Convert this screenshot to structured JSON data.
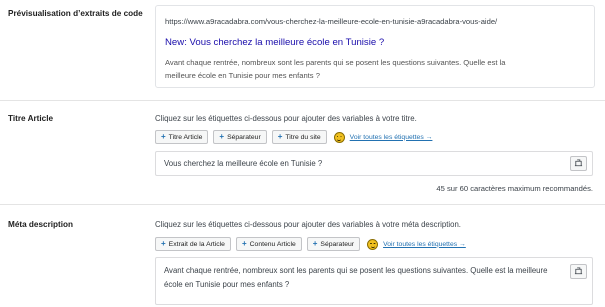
{
  "snippet_preview": {
    "label": "Prévisualisation d’extraits de code",
    "url": "https://www.a9racadabra.com/vous-cherchez-la-meilleure-ecole-en-tunisie-a9racadabra-vous-aide/",
    "title": "New: Vous cherchez la meilleure école en Tunisie ?",
    "description": "Avant chaque rentrée, nombreux sont les parents qui se posent les questions suivantes. Quelle est la meilleure école en Tunisie pour mes enfants ?"
  },
  "title_section": {
    "label": "Titre Article",
    "hint": "Cliquez sur les étiquettes ci-dessous pour ajouter des variables à votre titre.",
    "tags": [
      "Titre Article",
      "Séparateur",
      "Titre du site"
    ],
    "see_all": "Voir toutes les étiquettes →",
    "value": "Vous cherchez la meilleure école en Tunisie ?",
    "counter_current": "45",
    "counter_text_mid": " sur ",
    "counter_max": "60",
    "counter_text_end": " caractères maximum recommandés."
  },
  "meta_section": {
    "label": "Méta description",
    "hint": "Cliquez sur les étiquettes ci-dessous pour ajouter des variables à votre méta description.",
    "tags": [
      "Extrait de la Article",
      "Contenu Article",
      "Séparateur"
    ],
    "see_all": "Voir toutes les étiquettes →",
    "value": "Avant chaque rentrée, nombreux sont les parents qui se posent les questions suivantes. Quelle est la meilleure école en Tunisie pour mes enfants ?"
  },
  "colors": {
    "link_blue": "#2271b1",
    "preview_title": "#1a0dab",
    "emoji_yellow": "#f0c020"
  },
  "icons": [
    "plus-icon",
    "emoji-smiley-icon",
    "variable-insert-icon"
  ]
}
